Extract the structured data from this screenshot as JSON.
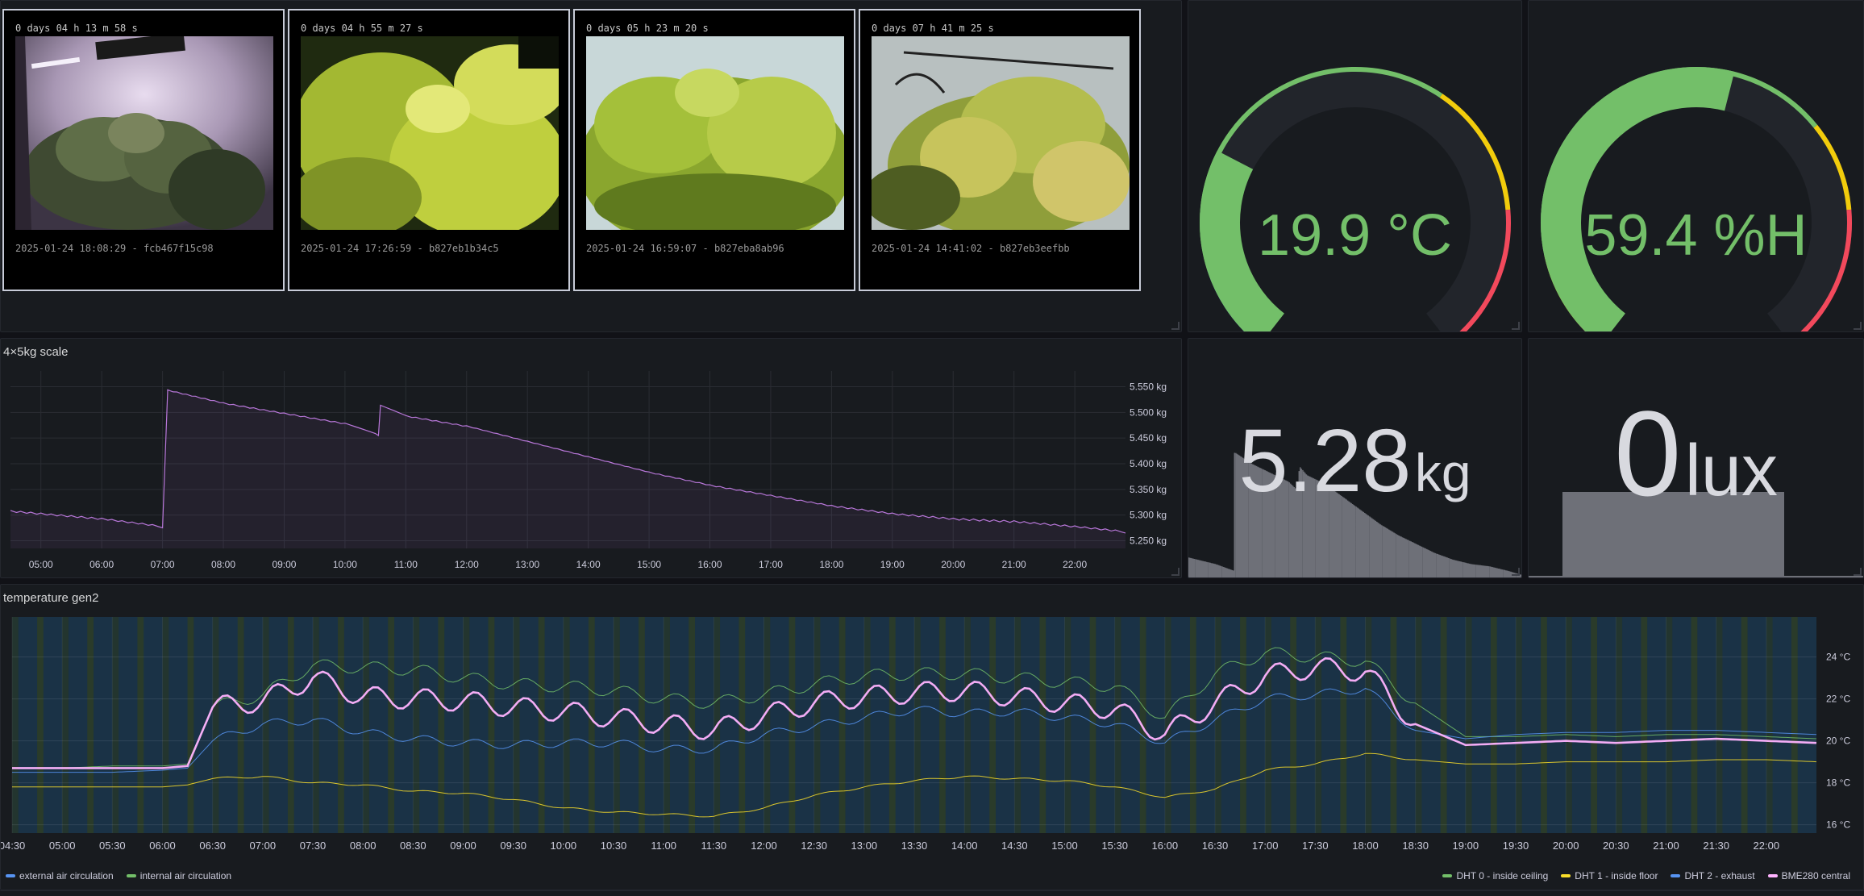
{
  "cameras": [
    {
      "uptime": "0 days 04 h 13 m 58 s",
      "caption": "2025-01-24 18:08:29 - fcb467f15c98"
    },
    {
      "uptime": "0 days 04 h 55 m 27 s",
      "caption": "2025-01-24 17:26:59 - b827eb1b34c5"
    },
    {
      "uptime": "0 days 05 h 23 m 20 s",
      "caption": "2025-01-24 16:59:07 - b827eba8ab96"
    },
    {
      "uptime": "0 days 07 h 41 m 25 s",
      "caption": "2025-01-24 14:41:02 - b827eb3eefbb"
    }
  ],
  "temperature_gauge": {
    "value": "19.9 °C",
    "fraction": 0.28,
    "color": "#73bf69"
  },
  "humidity_gauge": {
    "value": "59.4 %H",
    "fraction": 0.55,
    "color": "#73bf69"
  },
  "scale_panel": {
    "title": "4×5kg scale"
  },
  "weight_stat": {
    "value": "5.28",
    "unit": "kg"
  },
  "lux_stat": {
    "value": "0",
    "unit": "lux"
  },
  "temperature_panel": {
    "title": "temperature gen2"
  },
  "legend_left": [
    {
      "label": "external air circulation",
      "color": "#5794f2"
    },
    {
      "label": "internal air circulation",
      "color": "#73bf69"
    }
  ],
  "legend_right": [
    {
      "label": "DHT 0 - inside ceiling",
      "color": "#73bf69"
    },
    {
      "label": "DHT 1 - inside floor",
      "color": "#fade2a"
    },
    {
      "label": "DHT 2 - exhaust",
      "color": "#5794f2"
    },
    {
      "label": "BME280 central",
      "color": "#ffb3ff"
    }
  ],
  "chart_data": [
    {
      "type": "line",
      "title": "4×5kg scale",
      "x": [
        "04:30",
        "05:00",
        "06:00",
        "07:00",
        "07:05",
        "08:00",
        "09:00",
        "10:00",
        "10:30",
        "10:35",
        "11:00",
        "12:00",
        "13:00",
        "14:00",
        "15:00",
        "16:00",
        "17:00",
        "18:00",
        "19:00",
        "20:00",
        "21:00",
        "22:00",
        "22:50"
      ],
      "series": [
        {
          "values": [
            5.305,
            5.3,
            5.29,
            5.275,
            5.54,
            5.515,
            5.495,
            5.475,
            5.455,
            5.51,
            5.49,
            5.47,
            5.44,
            5.41,
            5.38,
            5.355,
            5.335,
            5.315,
            5.3,
            5.29,
            5.285,
            5.275,
            5.265
          ],
          "color": "#b877d9"
        }
      ],
      "ylim": [
        5.235,
        5.565
      ],
      "y_ticks": [
        "5.250 kg",
        "5.300 kg",
        "5.350 kg",
        "5.400 kg",
        "5.450 kg",
        "5.500 kg",
        "5.550 kg"
      ],
      "x_ticks": [
        "05:00",
        "06:00",
        "07:00",
        "08:00",
        "09:00",
        "10:00",
        "11:00",
        "12:00",
        "13:00",
        "14:00",
        "15:00",
        "16:00",
        "17:00",
        "18:00",
        "19:00",
        "20:00",
        "21:00",
        "22:00"
      ],
      "grid": true
    },
    {
      "type": "line",
      "title": "temperature gen2",
      "x": [
        "04:30",
        "05:00",
        "05:30",
        "06:00",
        "06:15",
        "06:30",
        "07:00",
        "07:30",
        "08:00",
        "08:30",
        "09:00",
        "09:30",
        "10:00",
        "10:30",
        "11:00",
        "11:30",
        "12:00",
        "12:30",
        "13:00",
        "13:30",
        "14:00",
        "14:30",
        "15:00",
        "15:30",
        "16:00",
        "16:30",
        "17:00",
        "17:30",
        "18:00",
        "18:30",
        "19:00",
        "19:30",
        "20:00",
        "20:30",
        "21:00",
        "21:30",
        "22:00",
        "22:30"
      ],
      "series": [
        {
          "name": "DHT 0 - inside ceiling",
          "color": "#73bf69",
          "values": [
            18.7,
            18.7,
            18.8,
            18.8,
            18.9,
            21.6,
            22.2,
            23.6,
            23.5,
            23.4,
            23.0,
            22.7,
            22.6,
            22.4,
            22.0,
            21.8,
            22.2,
            22.7,
            23.1,
            23.2,
            23.2,
            23.0,
            22.8,
            22.6,
            21.1,
            23.2,
            24.2,
            24.0,
            23.8,
            21.8,
            20.2,
            20.2,
            20.3,
            20.2,
            20.3,
            20.3,
            20.2,
            20.1
          ]
        },
        {
          "name": "DHT 1 - inside floor",
          "color": "#fade2a",
          "values": [
            17.8,
            17.8,
            17.8,
            17.8,
            17.9,
            18.2,
            18.3,
            18.0,
            17.9,
            17.6,
            17.5,
            17.2,
            16.8,
            16.6,
            16.5,
            16.4,
            16.8,
            17.4,
            17.8,
            18.1,
            18.3,
            18.2,
            18.1,
            17.8,
            17.3,
            17.7,
            18.6,
            18.9,
            19.4,
            19.1,
            18.9,
            18.9,
            19.0,
            19.0,
            19.0,
            19.1,
            19.1,
            19.0
          ]
        },
        {
          "name": "DHT 2 - exhaust",
          "color": "#5794f2",
          "values": [
            18.5,
            18.5,
            18.5,
            18.6,
            18.7,
            20.0,
            20.8,
            21.0,
            20.4,
            20.1,
            19.9,
            19.8,
            19.9,
            19.9,
            19.6,
            19.6,
            20.3,
            20.7,
            21.1,
            21.5,
            21.3,
            21.4,
            21.1,
            20.8,
            19.9,
            21.0,
            22.0,
            22.2,
            22.5,
            20.5,
            20.1,
            20.3,
            20.4,
            20.4,
            20.5,
            20.5,
            20.4,
            20.3
          ]
        },
        {
          "name": "BME280 central",
          "color": "#ffb3ff",
          "values": [
            18.7,
            18.7,
            18.7,
            18.7,
            18.8,
            21.6,
            21.9,
            23.0,
            22.1,
            22.0,
            21.9,
            21.6,
            21.4,
            21.1,
            20.8,
            20.5,
            21.2,
            21.8,
            22.1,
            22.3,
            22.4,
            22.1,
            21.8,
            21.5,
            20.3,
            21.8,
            23.1,
            23.5,
            23.3,
            20.8,
            19.8,
            19.9,
            20.0,
            19.9,
            20.0,
            20.1,
            20.0,
            19.9
          ]
        }
      ],
      "ylim": [
        15.6,
        25.6
      ],
      "y_ticks": [
        "16 °C",
        "18 °C",
        "20 °C",
        "22 °C",
        "24 °C"
      ],
      "x_ticks": [
        "04:30",
        "05:00",
        "05:30",
        "06:00",
        "06:30",
        "07:00",
        "07:30",
        "08:00",
        "08:30",
        "09:00",
        "09:30",
        "10:00",
        "10:30",
        "11:00",
        "11:30",
        "12:00",
        "12:30",
        "13:00",
        "13:30",
        "14:00",
        "14:30",
        "15:00",
        "15:30",
        "16:00",
        "16:30",
        "17:00",
        "17:30",
        "18:00",
        "18:30",
        "19:00",
        "19:30",
        "20:00",
        "20:30",
        "21:00",
        "21:30",
        "22:00"
      ],
      "grid": true
    }
  ]
}
